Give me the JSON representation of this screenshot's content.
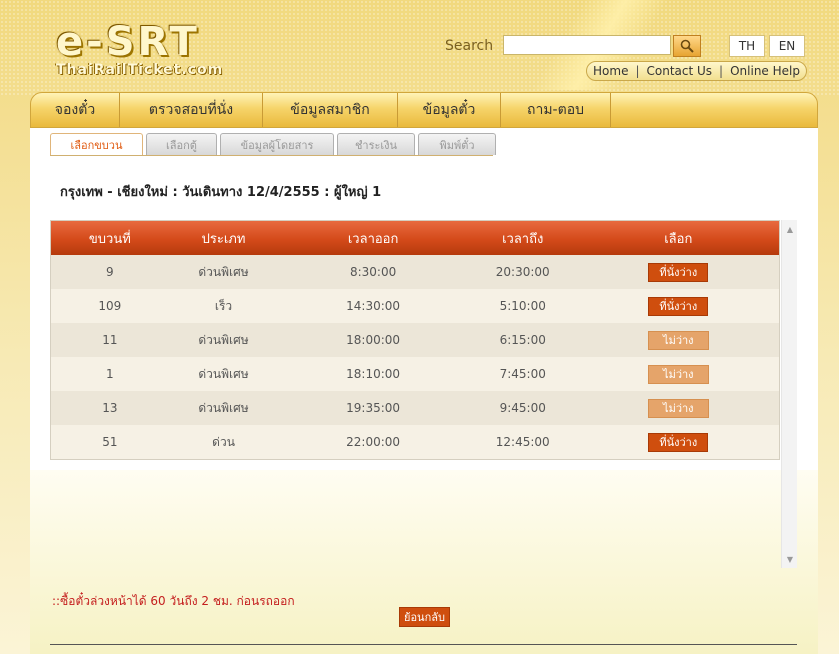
{
  "logo": {
    "main": "e-SRT",
    "sub": "ThaiRailTicket.com"
  },
  "search": {
    "label": "Search",
    "value": ""
  },
  "lang": {
    "th": "TH",
    "en": "EN"
  },
  "toplinks": [
    "Home",
    "Contact Us",
    "Online Help"
  ],
  "nav": [
    "จองตั๋ว",
    "ตรวจสอบที่นั่ง",
    "ข้อมูลสมาชิก",
    "ข้อมูลตั๋ว",
    "ถาม-ตอบ"
  ],
  "subtabs": [
    "เลือกขบวน",
    "เลือกตู้",
    "ข้อมูลผู้โดยสาร",
    "ชำระเงิน",
    "พิมพ์ตั๋ว"
  ],
  "route": "กรุงเทพ - เชียงใหม่ : วันเดินทาง 12/4/2555 : ผู้ใหญ่ 1",
  "table": {
    "headers": [
      "ขบวนที่",
      "ประเภท",
      "เวลาออก",
      "เวลาถึง",
      "เลือก"
    ],
    "rows": [
      {
        "train": "9",
        "type": "ด่วนพิเศษ",
        "depart": "8:30:00",
        "arrive": "20:30:00",
        "status": "ที่นั่งว่าง",
        "available": true
      },
      {
        "train": "109",
        "type": "เร็ว",
        "depart": "14:30:00",
        "arrive": "5:10:00",
        "status": "ที่นั่งว่าง",
        "available": true
      },
      {
        "train": "11",
        "type": "ด่วนพิเศษ",
        "depart": "18:00:00",
        "arrive": "6:15:00",
        "status": "ไม่ว่าง",
        "available": false
      },
      {
        "train": "1",
        "type": "ด่วนพิเศษ",
        "depart": "18:10:00",
        "arrive": "7:45:00",
        "status": "ไม่ว่าง",
        "available": false
      },
      {
        "train": "13",
        "type": "ด่วนพิเศษ",
        "depart": "19:35:00",
        "arrive": "9:45:00",
        "status": "ไม่ว่าง",
        "available": false
      },
      {
        "train": "51",
        "type": "ด่วน",
        "depart": "22:00:00",
        "arrive": "12:45:00",
        "status": "ที่นั่งว่าง",
        "available": true
      }
    ]
  },
  "note": "::ซื้อตั๋วล่วงหน้าได้ 60 วันถึง 2 ชม. ก่อนรถออก",
  "back_label": "ย้อนกลับ",
  "colors": {
    "accent": "#cf4e0e",
    "header_red": "#d44a1a",
    "note_red": "#c41e1e",
    "gold": "#f1d97e"
  }
}
